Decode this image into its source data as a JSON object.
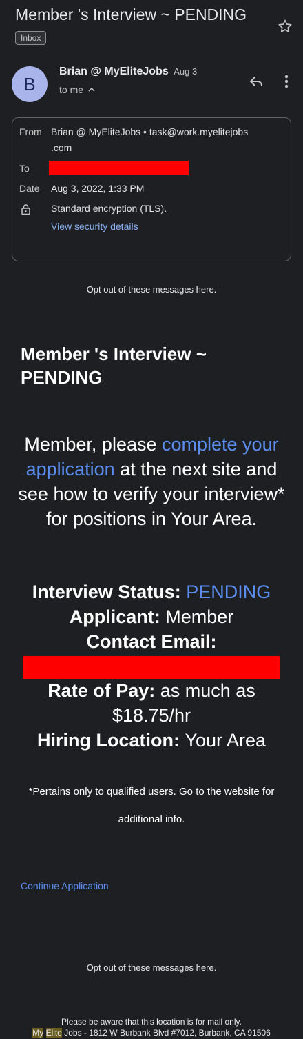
{
  "header": {
    "subject": "Member 's Interview ~ PENDING",
    "label": "Inbox"
  },
  "sender": {
    "avatar_letter": "B",
    "name": "Brian @ MyEliteJobs",
    "date": "Aug 3",
    "to_line": "to me"
  },
  "details": {
    "from_label": "From",
    "from_name": "Brian @ MyEliteJobs",
    "from_sep": " • ",
    "from_email_line1": "task@work.myelitejobs",
    "from_email_line2": ".com",
    "to_label": "To",
    "date_label": "Date",
    "date_value": "Aug 3, 2022, 1:33 PM",
    "encryption": "Standard encryption (TLS).",
    "security_link": "View security details"
  },
  "body": {
    "optout_top": "Opt out of these messages here.",
    "title_line1": "Member 's Interview ~",
    "title_line2": "PENDING",
    "para_start": "Member, please ",
    "para_link": "complete your application",
    "para_end": " at the next site and see how to verify your interview* for positions in Your Area.",
    "status_label": "Interview Status: ",
    "status_value": "PENDING",
    "applicant_label": "Applicant: ",
    "applicant_value": "Member",
    "contact_label": "Contact Email:",
    "pay_label": "Rate of Pay: ",
    "pay_value": "as much as $18.75/hr",
    "location_label": "Hiring Location: ",
    "location_value": "Your Area",
    "disclaimer": "*Pertains only to qualified users. Go to the website for additional info.",
    "continue_link": "Continue Application",
    "optout_bottom": "Opt out of these messages here.",
    "footer_line1": "Please be aware that this location is for mail only.",
    "footer_my": "My",
    "footer_elite": "Elite",
    "footer_rest": " Jobs - 1812 W Burbank Blvd #7012, Burbank, CA 91506"
  },
  "icons": {
    "star": "star-icon",
    "reply": "reply-icon",
    "more": "more-vert-icon",
    "lock": "lock-icon",
    "chevron": "chevron-up-icon"
  },
  "colors": {
    "background": "#1d1f22",
    "link": "#8ab4f8",
    "accent_blue": "#5b8def",
    "redaction": "#ff0000",
    "avatar_bg": "#a8b4ea"
  }
}
